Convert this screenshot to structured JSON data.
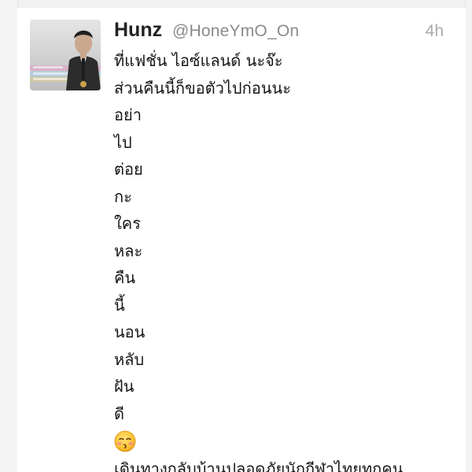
{
  "tweet": {
    "display_name": "Hunz",
    "handle": "@HoneYmO_On",
    "time": "4h",
    "avatar_icon": "user-avatar-photo",
    "lines_before_emoji": [
      "ที่แฟชั่น ไอซ์แลนด์ นะจ๊ะ",
      "ส่วนคืนนี้ก็ขอตัวไปก่อนนะ",
      "อย่า",
      "ไป",
      "ต่อย",
      "กะ",
      "ใคร",
      "หละ",
      "คืน",
      "นี้",
      "นอน",
      "หลับ",
      "ฝัน",
      "ดี"
    ],
    "emoji_icon": "kissing-face-closed-eyes-emoji",
    "lines_after_emoji": [
      "เดินทางกลับบ้านปลอดภัยนักกีฬาไทยทุกคน"
    ]
  }
}
